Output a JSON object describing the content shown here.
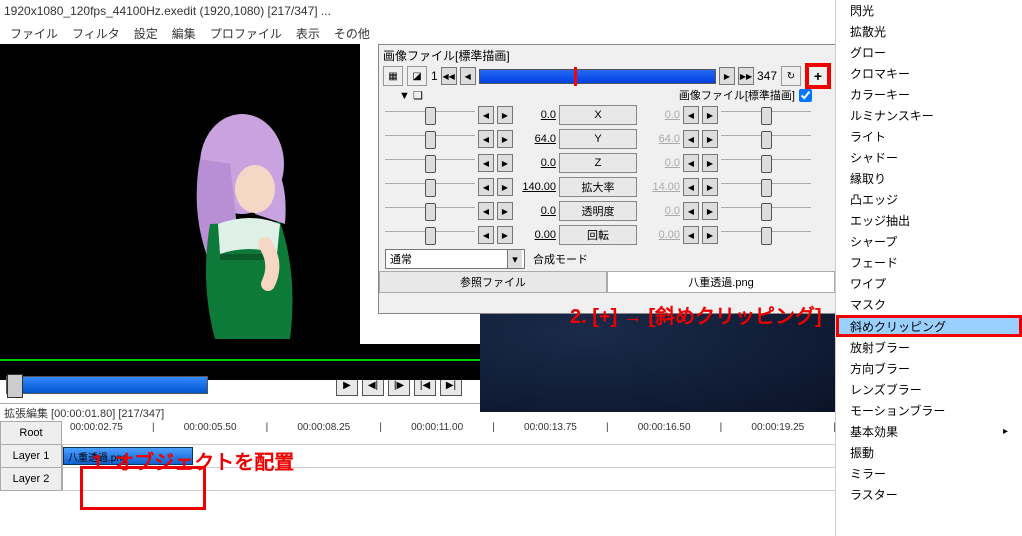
{
  "titlebar": "1920x1080_120fps_44100Hz.exedit  (1920,1080)  [217/347]  ...",
  "menu": [
    "ファイル",
    "フィルタ",
    "設定",
    "編集",
    "プロファイル",
    "表示",
    "その他"
  ],
  "panel": {
    "title": "画像ファイル[標準描画]",
    "frame_start": "1",
    "frame_end": "347",
    "type_label": "画像ファイル[標準描画]",
    "params": [
      {
        "l": "0.0",
        "n": "X",
        "r": "0.0"
      },
      {
        "l": "64.0",
        "n": "Y",
        "r": "64.0"
      },
      {
        "l": "0.0",
        "n": "Z",
        "r": "0.0"
      },
      {
        "l": "140.00",
        "n": "拡大率",
        "r": "14.00"
      },
      {
        "l": "0.0",
        "n": "透明度",
        "r": "0.0"
      },
      {
        "l": "0.00",
        "n": "回転",
        "r": "0.00"
      }
    ],
    "blend_value": "通常",
    "blend_label": "合成モード",
    "ref_label": "参照ファイル",
    "ref_value": "八重透過.png"
  },
  "timeline": {
    "header": "拡張編集 [00:00:01.80] [217/347]",
    "root": "Root",
    "ticks": [
      "00:00:02.75",
      "|",
      "00:00:05.50",
      "|",
      "00:00:08.25",
      "|",
      "00:00:11.00",
      "|",
      "00:00:13.75",
      "|",
      "00:00:16.50",
      "|",
      "00:00:19.25",
      "|"
    ],
    "layers": [
      "Layer 1",
      "Layer 2"
    ],
    "clip": "八重透過.png"
  },
  "annot": {
    "a1": "1. オブジェクトを配置",
    "a2": "2. [+] → [斜めクリッピング]"
  },
  "side_items": [
    {
      "t": "閃光",
      "more": false
    },
    {
      "t": "拡散光",
      "more": false
    },
    {
      "t": "グロー",
      "more": false
    },
    {
      "t": "クロマキー",
      "more": false
    },
    {
      "t": "カラーキー",
      "more": false
    },
    {
      "t": "ルミナンスキー",
      "more": false
    },
    {
      "t": "ライト",
      "more": false
    },
    {
      "t": "シャドー",
      "more": false
    },
    {
      "t": "縁取り",
      "more": false
    },
    {
      "t": "凸エッジ",
      "more": false
    },
    {
      "t": "エッジ抽出",
      "more": false
    },
    {
      "t": "シャープ",
      "more": false
    },
    {
      "t": "フェード",
      "more": false
    },
    {
      "t": "ワイプ",
      "more": false
    },
    {
      "t": "マスク",
      "more": false
    },
    {
      "t": "斜めクリッピング",
      "more": false,
      "sel": true
    },
    {
      "t": "放射ブラー",
      "more": false
    },
    {
      "t": "方向ブラー",
      "more": false
    },
    {
      "t": "レンズブラー",
      "more": false
    },
    {
      "t": "モーションブラー",
      "more": false
    },
    {
      "t": "基本効果",
      "more": true
    },
    {
      "t": "振動",
      "more": false
    },
    {
      "t": "ミラー",
      "more": false
    },
    {
      "t": "ラスター",
      "more": false
    }
  ]
}
